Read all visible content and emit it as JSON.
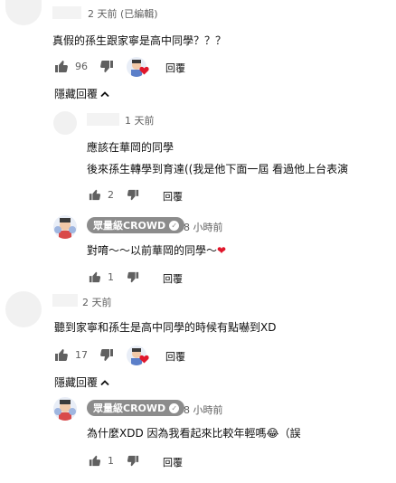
{
  "comments": [
    {
      "time": "2 天前 (已編輯)",
      "text": "真假的孫生跟家寧是高中同學？？？",
      "likes": "96",
      "reply_label": "回覆",
      "toggle_label": "隱藏回覆",
      "replies": [
        {
          "time": "1 天前",
          "lines": [
            "應該在華岡的同學",
            "後來孫生轉學到育達((我是他下面一屆  看過他上台表演"
          ],
          "likes": "2",
          "reply_label": "回覆"
        },
        {
          "author": "眾量級CROWD",
          "time": "8 小時前",
          "text": "對唷～～以前華岡的同學～",
          "emoji": "❤",
          "likes": "1",
          "reply_label": "回覆"
        }
      ]
    },
    {
      "time": "2 天前",
      "text": "聽到家寧和孫生是高中同學的時候有點嚇到XD",
      "likes": "17",
      "reply_label": "回覆",
      "toggle_label": "隱藏回覆",
      "replies": [
        {
          "author": "眾量級CROWD",
          "time": "8 小時前",
          "text": "為什麼XDD 因為我看起來比較年輕嗎",
          "emoji": "😂",
          "text_tail": "（誤",
          "likes": "1",
          "reply_label": "回覆"
        }
      ]
    }
  ],
  "colors": {
    "icon": "#606060",
    "badge": "#8c8c8c",
    "heart": "#e0162b"
  }
}
